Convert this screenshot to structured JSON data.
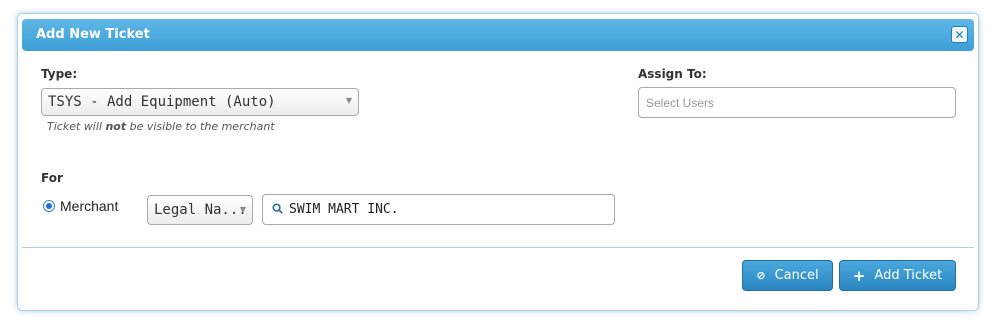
{
  "dialog": {
    "title": "Add New Ticket",
    "close_icon": "close-icon"
  },
  "type": {
    "label": "Type:",
    "selected": "TSYS - Add Equipment (Auto)",
    "hint_prefix": "Ticket will ",
    "hint_bold": "not",
    "hint_suffix": " be visible to the merchant"
  },
  "assign_to": {
    "label": "Assign To:",
    "placeholder": "Select Users"
  },
  "for": {
    "label": "For",
    "radio_label": "Merchant",
    "radio_checked": true,
    "field_select": "Legal Na...",
    "search_value": "SWIM MART INC.",
    "search_icon": "search-icon"
  },
  "buttons": {
    "cancel": "Cancel",
    "cancel_icon": "cancel-icon",
    "add": "Add Ticket",
    "add_icon": "plus-icon"
  },
  "colors": {
    "title_bar": "#3d9fd6",
    "button": "#2b86c1",
    "radio": "#1e6fd9"
  }
}
